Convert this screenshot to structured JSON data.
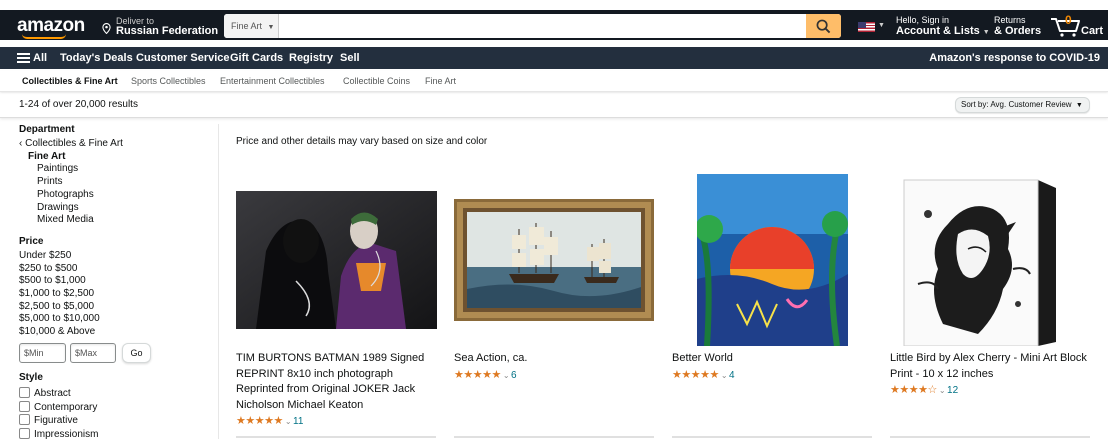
{
  "header": {
    "logo": "amazon",
    "deliver_to": "Deliver to",
    "location": "Russian Federation",
    "search_category": "Fine Art",
    "search_value": "",
    "account_line1": "Hello, Sign in",
    "account_line2": "Account & Lists",
    "returns_line1": "Returns",
    "returns_line2": "& Orders",
    "cart_count": "0",
    "cart_label": "Cart"
  },
  "subnav": {
    "all": "All",
    "items": [
      "Today's Deals",
      "Customer Service",
      "Gift Cards",
      "Registry",
      "Sell"
    ],
    "covid": "Amazon's response to COVID-19"
  },
  "categories": [
    "Collectibles & Fine Art",
    "Sports Collectibles",
    "Entertainment Collectibles",
    "Collectible Coins",
    "Fine Art"
  ],
  "results": {
    "count_text": "1-24 of over 20,000 results",
    "sort_label": "Sort by:",
    "sort_value": "Avg. Customer Review"
  },
  "sidebar": {
    "department_heading": "Department",
    "back_link": "Collectibles & Fine Art",
    "current": "Fine Art",
    "departments": [
      "Paintings",
      "Prints",
      "Photographs",
      "Drawings",
      "Mixed Media"
    ],
    "price_heading": "Price",
    "prices": [
      "Under $250",
      "$250 to $500",
      "$500 to $1,000",
      "$1,000 to $2,500",
      "$2,500 to $5,000",
      "$5,000 to $10,000",
      "$10,000 & Above"
    ],
    "min_placeholder": "$Min",
    "max_placeholder": "$Max",
    "go": "Go",
    "style_heading": "Style",
    "styles": [
      "Abstract",
      "Contemporary",
      "Figurative",
      "Impressionism"
    ]
  },
  "main": {
    "notice": "Price and other details may vary based on size and color",
    "products": [
      {
        "title": "TIM BURTONS BATMAN 1989 Signed REPRINT 8x10 inch photograph Reprinted from Original JOKER Jack Nicholson Michael Keaton",
        "stars": "★★★★★",
        "rating": 5,
        "reviews": "11"
      },
      {
        "title": "Sea Action, ca.",
        "stars": "★★★★★",
        "rating": 5,
        "reviews": "6"
      },
      {
        "title": "Better World",
        "stars": "★★★★★",
        "rating": 5,
        "reviews": "4"
      },
      {
        "title": "Little Bird by Alex Cherry - Mini Art Block Print - 10 x 12 inches",
        "stars": "★★★★☆",
        "rating": 4,
        "reviews": "12"
      }
    ]
  },
  "colors": {
    "nav_dark": "#131921",
    "nav_sub": "#232f3e",
    "search_button": "#febd69",
    "star": "#de7921",
    "link": "#007185"
  }
}
